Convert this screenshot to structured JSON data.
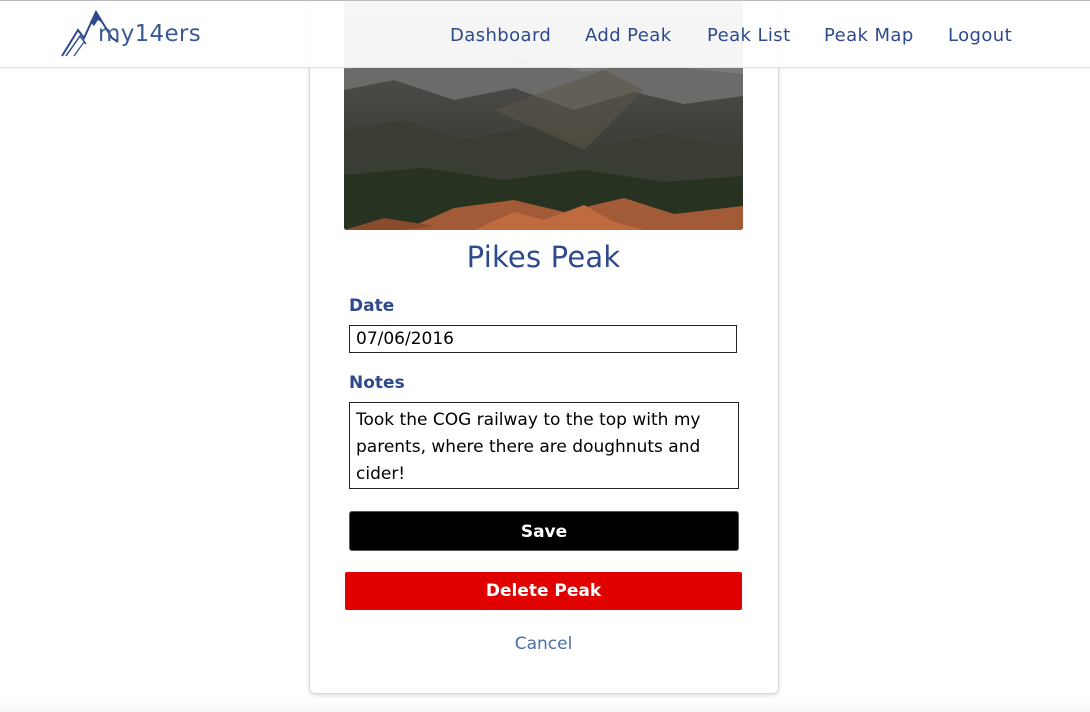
{
  "brand": {
    "logo_text": "my14ers"
  },
  "nav": {
    "items": [
      {
        "label": "Dashboard"
      },
      {
        "label": "Add Peak"
      },
      {
        "label": "Peak List"
      },
      {
        "label": "Peak Map"
      },
      {
        "label": "Logout"
      }
    ]
  },
  "peak": {
    "name": "Pikes Peak",
    "date_label": "Date",
    "date_value": "07/06/2016",
    "notes_label": "Notes",
    "notes_value": "Took the COG railway to the top with my parents, where there are doughnuts and cider!"
  },
  "actions": {
    "save_label": "Save",
    "delete_label": "Delete Peak",
    "cancel_label": "Cancel"
  },
  "colors": {
    "brand_blue": "#2e4a8e",
    "save_bg": "#000000",
    "delete_bg": "#e00000",
    "cancel_link": "#4a6fa5"
  }
}
